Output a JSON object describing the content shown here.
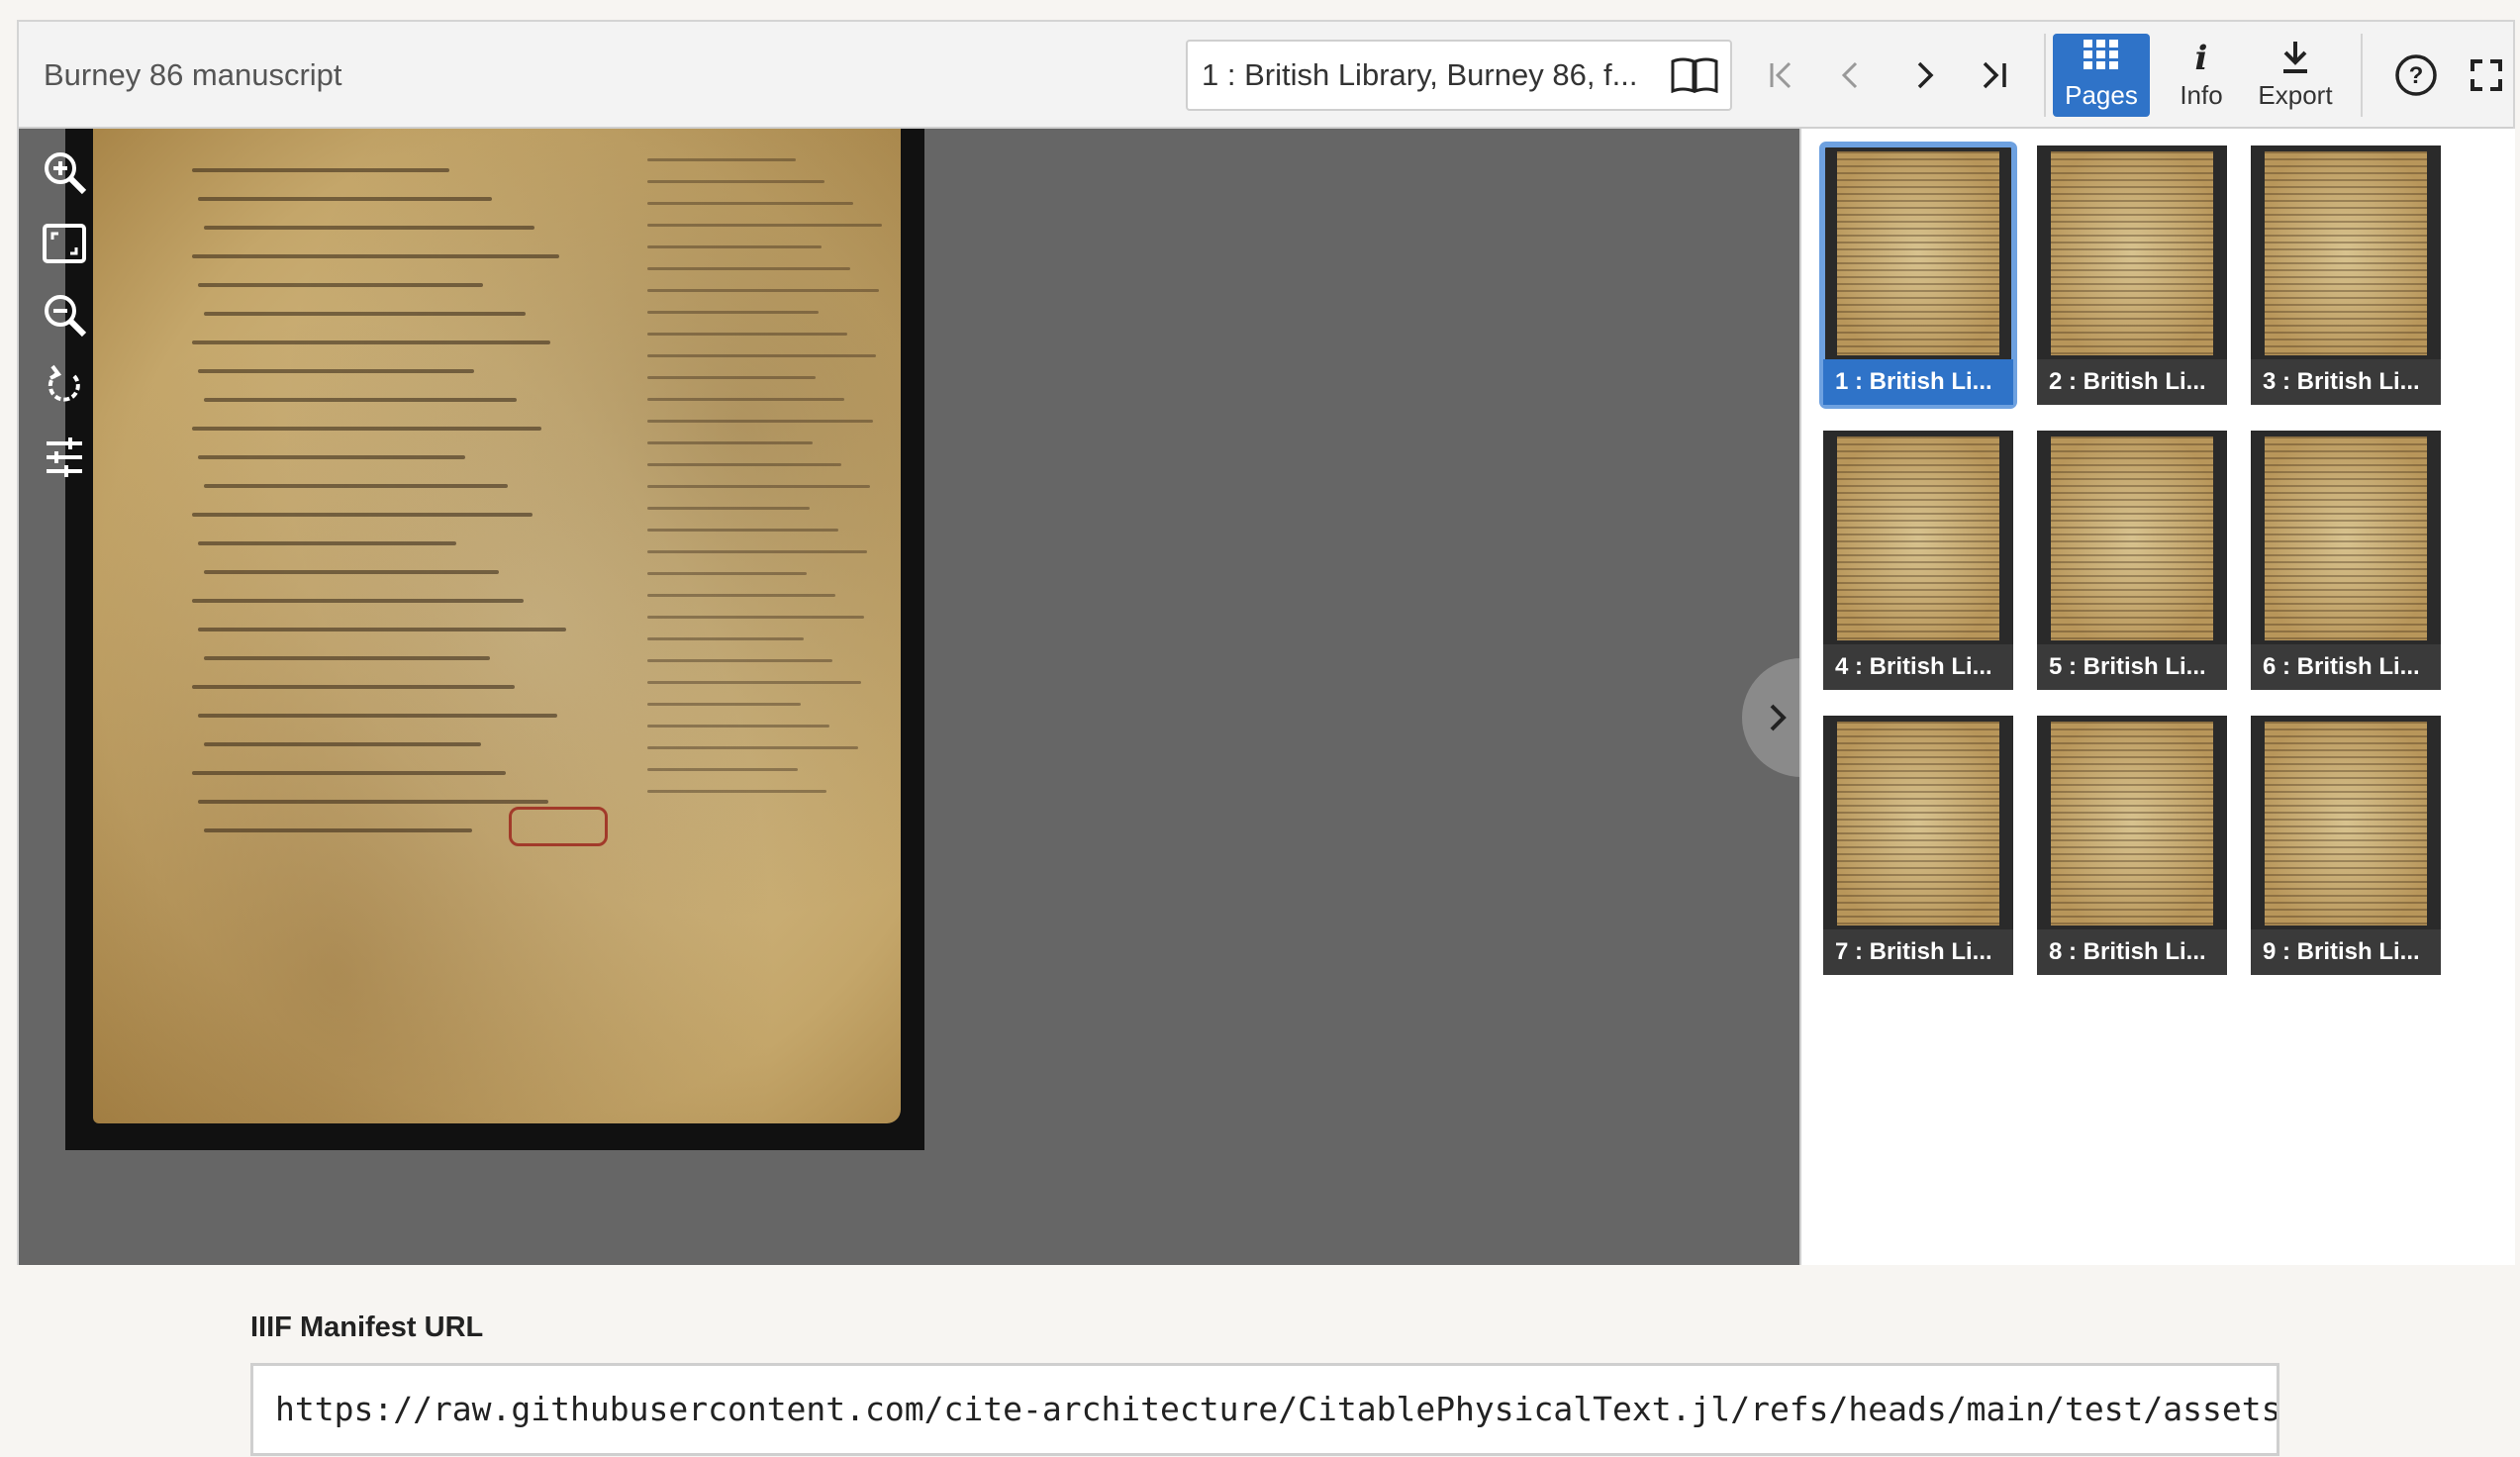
{
  "viewer": {
    "title": "Burney 86 manuscript",
    "page_selector": "1 : British Library, Burney 86, f...",
    "toolbar": {
      "pages_label": "Pages",
      "info_label": "Info",
      "export_label": "Export"
    }
  },
  "thumbnails": [
    {
      "label": "1 : British Li..."
    },
    {
      "label": "2 : British Li..."
    },
    {
      "label": "3 : British Li..."
    },
    {
      "label": "4 : British Li..."
    },
    {
      "label": "5 : British Li..."
    },
    {
      "label": "6 : British Li..."
    },
    {
      "label": "7 : British Li..."
    },
    {
      "label": "8 : British Li..."
    },
    {
      "label": "9 : British Li..."
    }
  ],
  "manifest": {
    "label": "IIIF Manifest URL",
    "value": "https://raw.githubusercontent.com/cite-architecture/CitablePhysicalText.jl/refs/heads/main/test/assets/b"
  },
  "colors": {
    "accent": "#2f73c8",
    "selected_outline": "#6ea1e0"
  }
}
